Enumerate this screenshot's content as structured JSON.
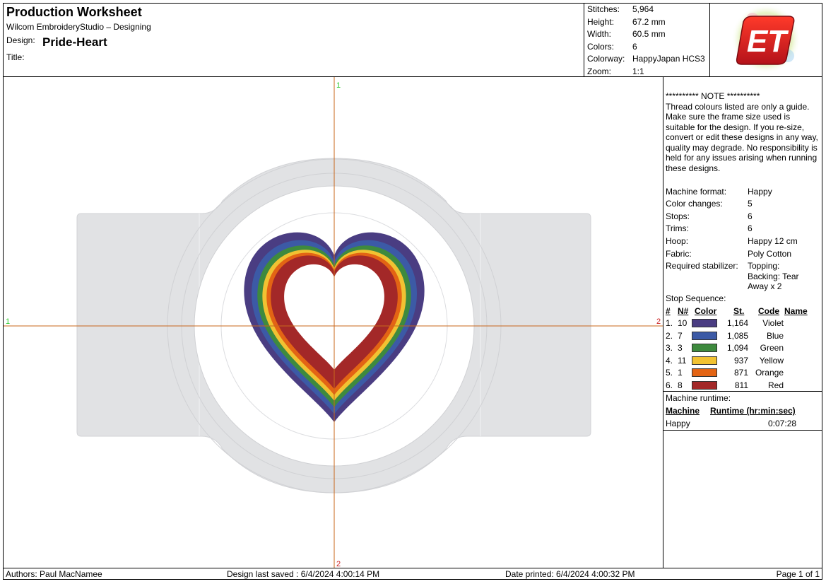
{
  "header": {
    "title": "Production Worksheet",
    "app_name": "Wilcom EmbroideryStudio – Designing",
    "design_label": "Design:",
    "design_name": "Pride-Heart",
    "title_label": "Title:",
    "title_value": ""
  },
  "stats": [
    {
      "label": "Stitches:",
      "value": "5,964"
    },
    {
      "label": "Height:",
      "value": "67.2 mm"
    },
    {
      "label": "Width:",
      "value": "60.5 mm"
    },
    {
      "label": "Colors:",
      "value": "6"
    },
    {
      "label": "Colorway:",
      "value": "HappyJapan HCS3"
    },
    {
      "label": "Zoom:",
      "value": "1:1"
    }
  ],
  "logo": {
    "text": "ET"
  },
  "canvas": {
    "markers": {
      "top": "1",
      "left": "1",
      "right": "2",
      "bottom": "2"
    },
    "axis_color": "#c8671b",
    "hoop_color": "#e1e2e4"
  },
  "note": {
    "heading": "********** NOTE **********",
    "body": "Thread colours listed are only a guide. Make sure the frame size used is suitable for the design. If you re-size, convert or edit these designs in any way, quality may degrade. No responsibility is held for any issues arising when running these designs."
  },
  "machine_info": [
    {
      "label": "Machine format:",
      "value": "Happy"
    },
    {
      "label": "Color changes:",
      "value": "5"
    },
    {
      "label": "Stops:",
      "value": "6"
    },
    {
      "label": "Trims:",
      "value": "6"
    },
    {
      "label": "Hoop:",
      "value": "Happy 12 cm"
    },
    {
      "label": "Fabric:",
      "value": "Poly Cotton"
    },
    {
      "label": "Required stabilizer:",
      "value": "Topping:\nBacking: Tear Away x 2"
    }
  ],
  "stop_sequence": {
    "title": "Stop Sequence:",
    "headers": {
      "num": "#",
      "n": "N#",
      "color": "Color",
      "st": "St.",
      "code": "Code",
      "name": "Name"
    },
    "rows": [
      {
        "num": "1.",
        "n": "10",
        "color": "#4a3d82",
        "st": "1,164",
        "code": "Violet"
      },
      {
        "num": "2.",
        "n": "7",
        "color": "#3c5aa6",
        "st": "1,085",
        "code": "Blue"
      },
      {
        "num": "3.",
        "n": "3",
        "color": "#3e8a3e",
        "st": "1,094",
        "code": "Green"
      },
      {
        "num": "4.",
        "n": "11",
        "color": "#f1c232",
        "st": "937",
        "code": "Yellow"
      },
      {
        "num": "5.",
        "n": "1",
        "color": "#e36414",
        "st": "871",
        "code": "Orange"
      },
      {
        "num": "6.",
        "n": "8",
        "color": "#a32828",
        "st": "811",
        "code": "Red"
      }
    ]
  },
  "runtime": {
    "label": "Machine runtime:",
    "machine_header": "Machine",
    "runtime_header": "Runtime (hr:min:sec)",
    "machine": "Happy",
    "time": "0:07:28"
  },
  "footer": {
    "authors": "Authors: Paul MacNamee",
    "last_saved": "Design last saved : 6/4/2024 4:00:14 PM",
    "printed": "Date printed: 6/4/2024 4:00:32 PM",
    "page": "Page 1 of 1"
  }
}
